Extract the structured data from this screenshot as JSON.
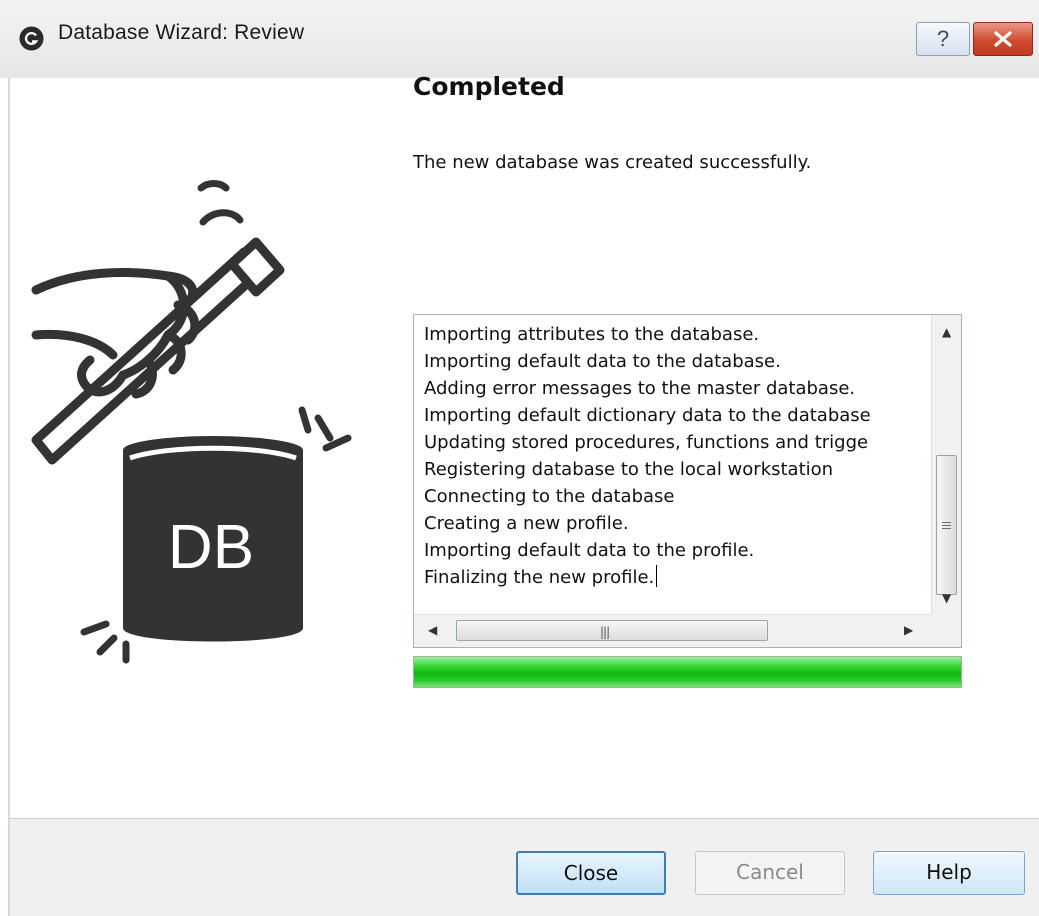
{
  "window": {
    "title": "Database Wizard: Review",
    "help_button": "?",
    "close_button": "close"
  },
  "content": {
    "heading": "Completed",
    "message": "The new database was created successfully.",
    "illustration": {
      "label": "DB"
    },
    "log_lines": [
      "Importing attributes to the database.",
      "Importing default data to the database.",
      "Adding error messages to the master database.",
      "Importing default dictionary data to the database",
      "Updating stored procedures, functions and trigge",
      "Registering database to the local workstation",
      "Connecting to the database",
      "Creating a new profile.",
      "Importing default data to the profile.",
      "Finalizing the new profile."
    ],
    "progress_fraction": 1.0
  },
  "buttons": {
    "close": "Close",
    "cancel": "Cancel",
    "help": "Help"
  },
  "colors": {
    "progress_green": "#16c216",
    "titlebar_close_red": "#cf4b30",
    "default_button_border": "#3c7fb1",
    "illustration_dark": "#333333"
  }
}
